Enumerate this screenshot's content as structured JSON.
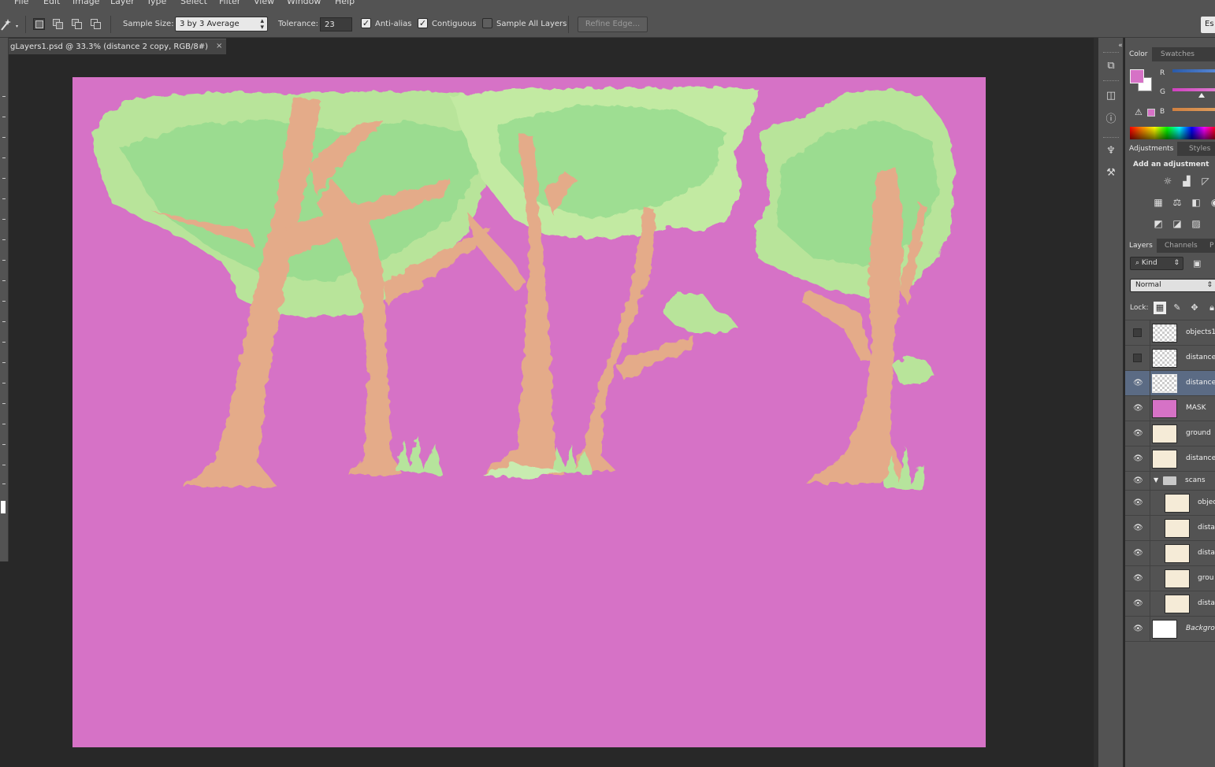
{
  "menu": [
    "File",
    "Edit",
    "Image",
    "Layer",
    "Type",
    "Select",
    "Filter",
    "View",
    "Window",
    "Help"
  ],
  "options": {
    "sample_size_label": "Sample Size:",
    "sample_size_value": "3 by 3 Average",
    "tolerance_label": "Tolerance:",
    "tolerance_value": "23",
    "anti_alias_label": "Anti-alias",
    "anti_alias_checked": true,
    "contiguous_label": "Contiguous",
    "contiguous_checked": true,
    "sample_all_label": "Sample All Layers",
    "sample_all_checked": false,
    "refine_edge_label": "Refine Edge...",
    "es_label": "Es"
  },
  "document": {
    "tab_title": "gLayers1.psd @ 33.3% (distance 2 copy, RGB/8#)",
    "close_glyph": "×",
    "canvas_color": "#d672c6"
  },
  "color_panel": {
    "tabs": [
      "Color",
      "Swatches"
    ],
    "channels": [
      "R",
      "G",
      "B"
    ],
    "foreground": "#d672c6",
    "background": "#ffffff"
  },
  "adjustments_panel": {
    "tabs": [
      "Adjustments",
      "Styles"
    ],
    "title": "Add an adjustment"
  },
  "layers_panel": {
    "tabs": [
      "Layers",
      "Channels",
      "P"
    ],
    "filter_label": "Kind",
    "blend_mode": "Normal",
    "lock_label": "Lock:",
    "layers": [
      {
        "name": "objects1",
        "visible": false,
        "thumb": "checker",
        "indent": false,
        "selected": false
      },
      {
        "name": "distance",
        "visible": false,
        "thumb": "checker",
        "indent": false,
        "selected": false
      },
      {
        "name": "distance",
        "visible": true,
        "thumb": "checker",
        "indent": false,
        "selected": true
      },
      {
        "name": "MASK",
        "visible": true,
        "thumb": "pink",
        "indent": false,
        "selected": false
      },
      {
        "name": "ground",
        "visible": true,
        "thumb": "paper",
        "indent": false,
        "selected": false
      },
      {
        "name": "distance",
        "visible": true,
        "thumb": "paper",
        "indent": false,
        "selected": false
      },
      {
        "name": "scans",
        "visible": true,
        "thumb": "folder",
        "indent": false,
        "selected": false
      },
      {
        "name": "objec",
        "visible": true,
        "thumb": "paper",
        "indent": true,
        "selected": false
      },
      {
        "name": "dista",
        "visible": true,
        "thumb": "paper",
        "indent": true,
        "selected": false
      },
      {
        "name": "dista",
        "visible": true,
        "thumb": "paper",
        "indent": true,
        "selected": false
      },
      {
        "name": "grou",
        "visible": true,
        "thumb": "paper",
        "indent": true,
        "selected": false
      },
      {
        "name": "dista",
        "visible": true,
        "thumb": "paper",
        "indent": true,
        "selected": false
      },
      {
        "name": "Backgro",
        "visible": true,
        "thumb": "white",
        "indent": false,
        "selected": false
      }
    ]
  }
}
